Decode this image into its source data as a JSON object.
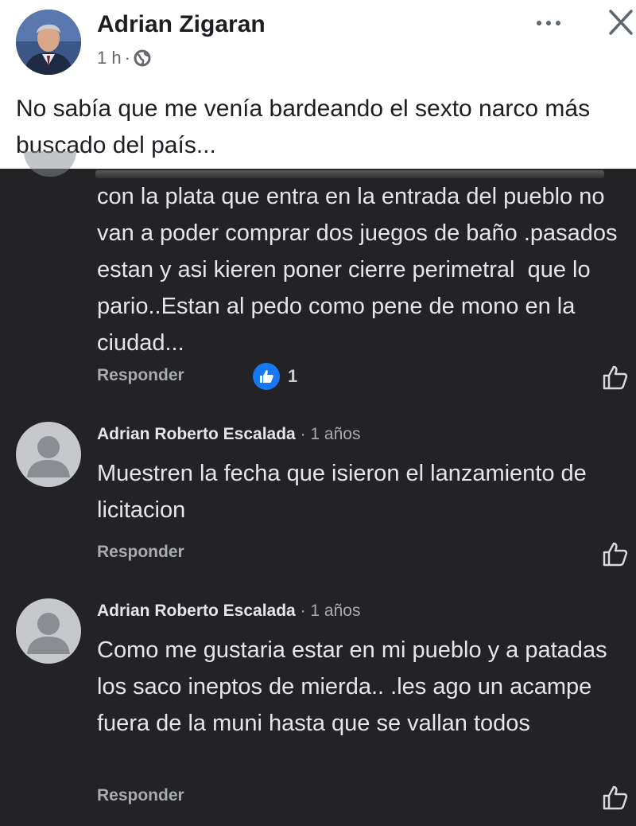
{
  "post": {
    "author": "Adrian Zigaran",
    "time": "1 h",
    "separator": "·",
    "text": "No sabía que me venía bardeando el sexto narco más buscado del país..."
  },
  "comments": [
    {
      "text": "con la plata que entra en la entrada del pueblo no van a poder comprar dos juegos de baño .pasados estan y asi kieren poner cierre perimetral  que lo pario..Estan al pedo como pene de mono en la ciudad...",
      "reply_label": "Responder",
      "reaction_count": "1"
    },
    {
      "author": "Adrian Roberto Escalada",
      "time": "· 1 años",
      "text": "Muestren la fecha que isieron el lanzamiento de licitacion",
      "reply_label": "Responder"
    },
    {
      "author": "Adrian Roberto Escalada",
      "time": "· 1 años",
      "text": "Como me gustaria estar en mi pueblo y a patadas los saco ineptos de mierda.. .les ago un acampe fuera de la muni hasta que se vallan todos",
      "reply_label": "Responder"
    }
  ],
  "colors": {
    "background_dark": "#232325",
    "header_bg": "#ffffff",
    "reaction_blue": "#1877f2"
  },
  "icons": [
    "globe-icon",
    "more-options-icon",
    "close-icon",
    "like-reaction-icon",
    "thumbs-up-icon",
    "default-avatar-icon"
  ]
}
